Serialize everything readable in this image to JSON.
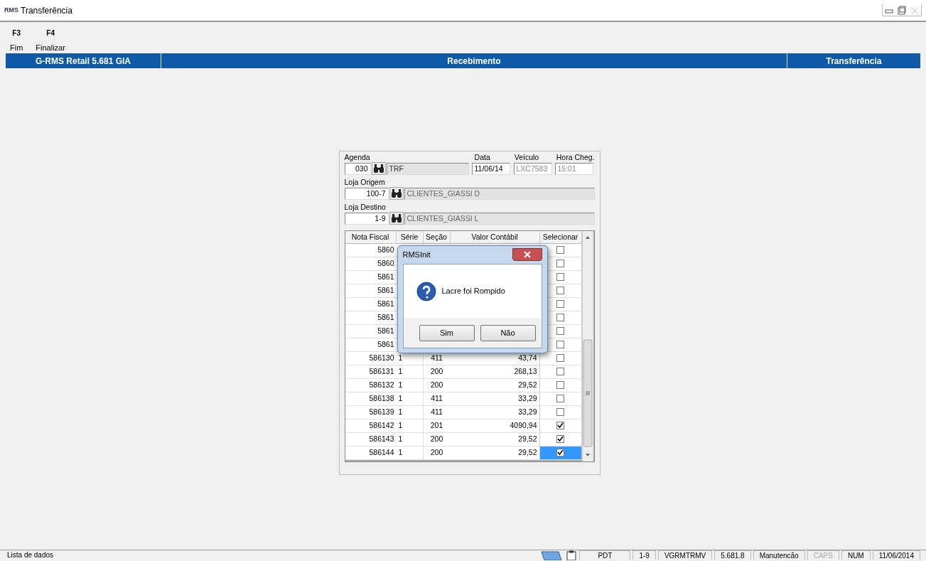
{
  "window": {
    "title": "Transferência",
    "logo": "RMS"
  },
  "toolbar": [
    {
      "key": "F3",
      "label": "Fim"
    },
    {
      "key": "F4",
      "label": "Finalizar"
    }
  ],
  "header": {
    "app": "G-RMS Retail 5.681 GIA",
    "module": "Recebimento",
    "screen": "Transferência"
  },
  "form": {
    "agenda_label": "Agenda",
    "agenda": "030",
    "agenda_desc": "TRF",
    "data_label": "Data",
    "data": "11/06/14",
    "veiculo_label": "Veículo",
    "veiculo": "LXC7583",
    "hora_label": "Hora Cheg.",
    "hora": "15:01",
    "origem_label": "Loja Origem",
    "origem": "100-7",
    "origem_desc": "CLIENTES_GIASSI D",
    "destino_label": "Loja Destino",
    "destino": "1-9",
    "destino_desc": "CLIENTES_GIASSI L"
  },
  "table": {
    "columns": [
      "Nota Fiscal",
      "Série",
      "Seção",
      "Valor Contábil",
      "Selecionar"
    ],
    "rows": [
      {
        "nota": "5860",
        "checked": false,
        "selected": false
      },
      {
        "nota": "5860",
        "checked": false,
        "selected": false
      },
      {
        "nota": "5861",
        "checked": false,
        "selected": false
      },
      {
        "nota": "5861",
        "checked": false,
        "selected": false
      },
      {
        "nota": "5861",
        "checked": false,
        "selected": false
      },
      {
        "nota": "5861",
        "checked": false,
        "selected": false
      },
      {
        "nota": "5861",
        "checked": false,
        "selected": false
      },
      {
        "nota": "5861",
        "checked": false,
        "selected": false
      },
      {
        "nota": "586130",
        "serie": "1",
        "secao": "411",
        "valor": "43,74",
        "checked": false,
        "selected": false
      },
      {
        "nota": "586131",
        "serie": "1",
        "secao": "200",
        "valor": "268,13",
        "checked": false,
        "selected": false
      },
      {
        "nota": "586132",
        "serie": "1",
        "secao": "200",
        "valor": "29,52",
        "checked": false,
        "selected": false
      },
      {
        "nota": "586138",
        "serie": "1",
        "secao": "411",
        "valor": "33,29",
        "checked": false,
        "selected": false
      },
      {
        "nota": "586139",
        "serie": "1",
        "secao": "411",
        "valor": "33,29",
        "checked": false,
        "selected": false
      },
      {
        "nota": "586142",
        "serie": "1",
        "secao": "201",
        "valor": "4090,94",
        "checked": true,
        "selected": false
      },
      {
        "nota": "586143",
        "serie": "1",
        "secao": "200",
        "valor": "29,52",
        "checked": true,
        "selected": false
      },
      {
        "nota": "586144",
        "serie": "1",
        "secao": "200",
        "valor": "29,52",
        "checked": true,
        "selected": true
      }
    ]
  },
  "dialog": {
    "title": "RMSInit",
    "message": "Lacre foi Rompido",
    "buttons": [
      "Sim",
      "Não"
    ]
  },
  "status_bar": {
    "message": "Lista de dados",
    "panels": [
      {
        "text": "PDT",
        "disabled": false
      },
      {
        "text": "1-9",
        "disabled": false
      },
      {
        "text": "VGRMTRMV",
        "disabled": false
      },
      {
        "text": "5.681.8",
        "disabled": false
      },
      {
        "text": "Manutencão",
        "disabled": false
      },
      {
        "text": "CAPS",
        "disabled": true
      },
      {
        "text": "NUM",
        "disabled": false
      },
      {
        "text": "11/06/2014",
        "disabled": false
      }
    ]
  }
}
